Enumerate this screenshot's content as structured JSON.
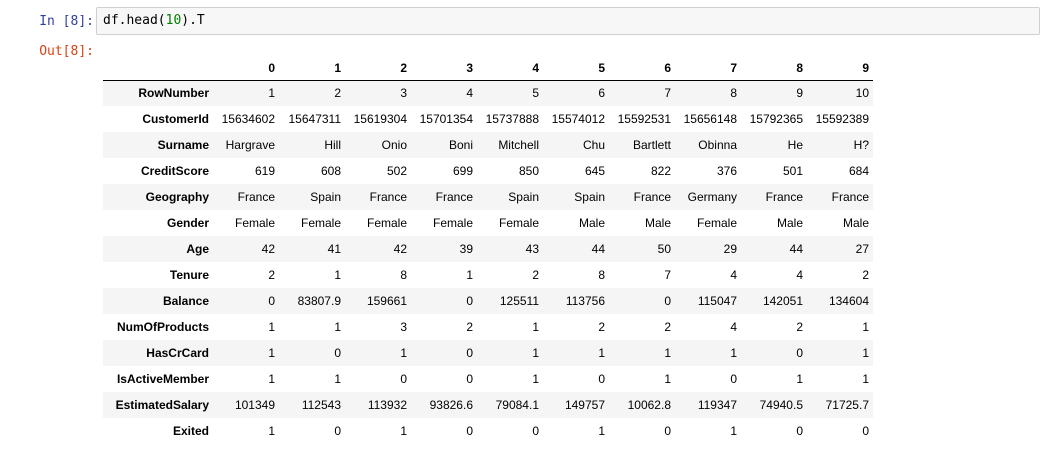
{
  "cell": {
    "in_prompt": "In [8]:",
    "out_prompt": "Out[8]:",
    "code_prefix": "df.head(",
    "code_number": "10",
    "code_suffix": ").T"
  },
  "table": {
    "columns": [
      "0",
      "1",
      "2",
      "3",
      "4",
      "5",
      "6",
      "7",
      "8",
      "9"
    ],
    "rows": [
      {
        "label": "RowNumber",
        "values": [
          "1",
          "2",
          "3",
          "4",
          "5",
          "6",
          "7",
          "8",
          "9",
          "10"
        ]
      },
      {
        "label": "CustomerId",
        "values": [
          "15634602",
          "15647311",
          "15619304",
          "15701354",
          "15737888",
          "15574012",
          "15592531",
          "15656148",
          "15792365",
          "15592389"
        ]
      },
      {
        "label": "Surname",
        "values": [
          "Hargrave",
          "Hill",
          "Onio",
          "Boni",
          "Mitchell",
          "Chu",
          "Bartlett",
          "Obinna",
          "He",
          "H?"
        ]
      },
      {
        "label": "CreditScore",
        "values": [
          "619",
          "608",
          "502",
          "699",
          "850",
          "645",
          "822",
          "376",
          "501",
          "684"
        ]
      },
      {
        "label": "Geography",
        "values": [
          "France",
          "Spain",
          "France",
          "France",
          "Spain",
          "Spain",
          "France",
          "Germany",
          "France",
          "France"
        ]
      },
      {
        "label": "Gender",
        "values": [
          "Female",
          "Female",
          "Female",
          "Female",
          "Female",
          "Male",
          "Male",
          "Female",
          "Male",
          "Male"
        ]
      },
      {
        "label": "Age",
        "values": [
          "42",
          "41",
          "42",
          "39",
          "43",
          "44",
          "50",
          "29",
          "44",
          "27"
        ]
      },
      {
        "label": "Tenure",
        "values": [
          "2",
          "1",
          "8",
          "1",
          "2",
          "8",
          "7",
          "4",
          "4",
          "2"
        ]
      },
      {
        "label": "Balance",
        "values": [
          "0",
          "83807.9",
          "159661",
          "0",
          "125511",
          "113756",
          "0",
          "115047",
          "142051",
          "134604"
        ]
      },
      {
        "label": "NumOfProducts",
        "values": [
          "1",
          "1",
          "3",
          "2",
          "1",
          "2",
          "2",
          "4",
          "2",
          "1"
        ]
      },
      {
        "label": "HasCrCard",
        "values": [
          "1",
          "0",
          "1",
          "0",
          "1",
          "1",
          "1",
          "1",
          "0",
          "1"
        ]
      },
      {
        "label": "IsActiveMember",
        "values": [
          "1",
          "1",
          "0",
          "0",
          "1",
          "0",
          "1",
          "0",
          "1",
          "1"
        ]
      },
      {
        "label": "EstimatedSalary",
        "values": [
          "101349",
          "112543",
          "113932",
          "93826.6",
          "79084.1",
          "149757",
          "10062.8",
          "119347",
          "74940.5",
          "71725.7"
        ]
      },
      {
        "label": "Exited",
        "values": [
          "1",
          "0",
          "1",
          "0",
          "0",
          "1",
          "0",
          "1",
          "0",
          "0"
        ]
      }
    ]
  }
}
